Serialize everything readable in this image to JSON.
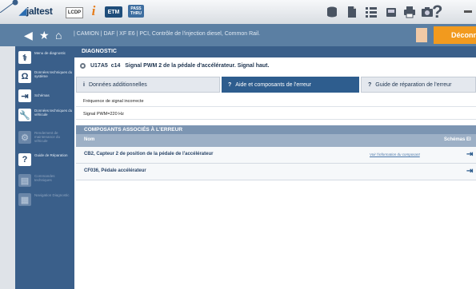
{
  "app": {
    "logo_text": "jaltest",
    "toolbar": {
      "lcdp_label": "LCDP",
      "etm_label": "ETM",
      "pass_line1": "PASS",
      "pass_line2": "THRU",
      "help_label": "?"
    }
  },
  "nav": {
    "breadcrumb": "| CAMION | DAF | XF E6 | PCI, Contrôle de l'injection diesel, Common Rail.",
    "disconnect_label": "Déconne"
  },
  "sidebar": {
    "items": [
      {
        "label": "Menu de diagnostic",
        "icon": "stethoscope-icon"
      },
      {
        "label": "Données techniques du système",
        "icon": "ohm-icon"
      },
      {
        "label": "Schémas",
        "icon": "schema-icon"
      },
      {
        "label": "Données techniques du véhicule",
        "icon": "wrench-icon"
      },
      {
        "label": "Rendement de maintenance du véhicule",
        "icon": "maintenance-icon"
      },
      {
        "label": "Guide de Réparation",
        "icon": "repair-guide-icon"
      },
      {
        "label": "Commandes techniques",
        "icon": "commands-icon"
      },
      {
        "label": "Navigation Diagnostic",
        "icon": "navigation-icon"
      }
    ]
  },
  "main": {
    "section_title": "DIAGNOSTIC",
    "fault": {
      "code": "U17A5",
      "sub": "c14",
      "description": "Signal PWM 2 de la pédale d'accélérateur. Signal haut."
    },
    "tabs": [
      {
        "label": "Données additionnelles",
        "icon": "i"
      },
      {
        "label": "Aide et composants de l'erreur",
        "icon": "?"
      },
      {
        "label": "Guide de réparation de l'erreur",
        "icon": "?"
      }
    ],
    "info_lines": [
      "Fréquence de signal incorrecte",
      "Signal PWM=220 Hz"
    ],
    "components_title": "COMPOSANTS ASSOCIÉS À L'ERREUR",
    "columns": {
      "name": "Nom",
      "schemas": "Schémas El"
    },
    "rows": [
      {
        "name": "CB2, Capteur 2 de position de la pédale de l'accélérateur",
        "link": "Voir l'information du composant"
      },
      {
        "name": "CF036, Pédale accélérateur",
        "link": ""
      }
    ]
  },
  "colors": {
    "nav_blue": "#5b7fa3",
    "sidebar_blue": "#3a5f8a",
    "active_tab": "#2e5d8e",
    "accent_orange": "#f29a1e"
  }
}
